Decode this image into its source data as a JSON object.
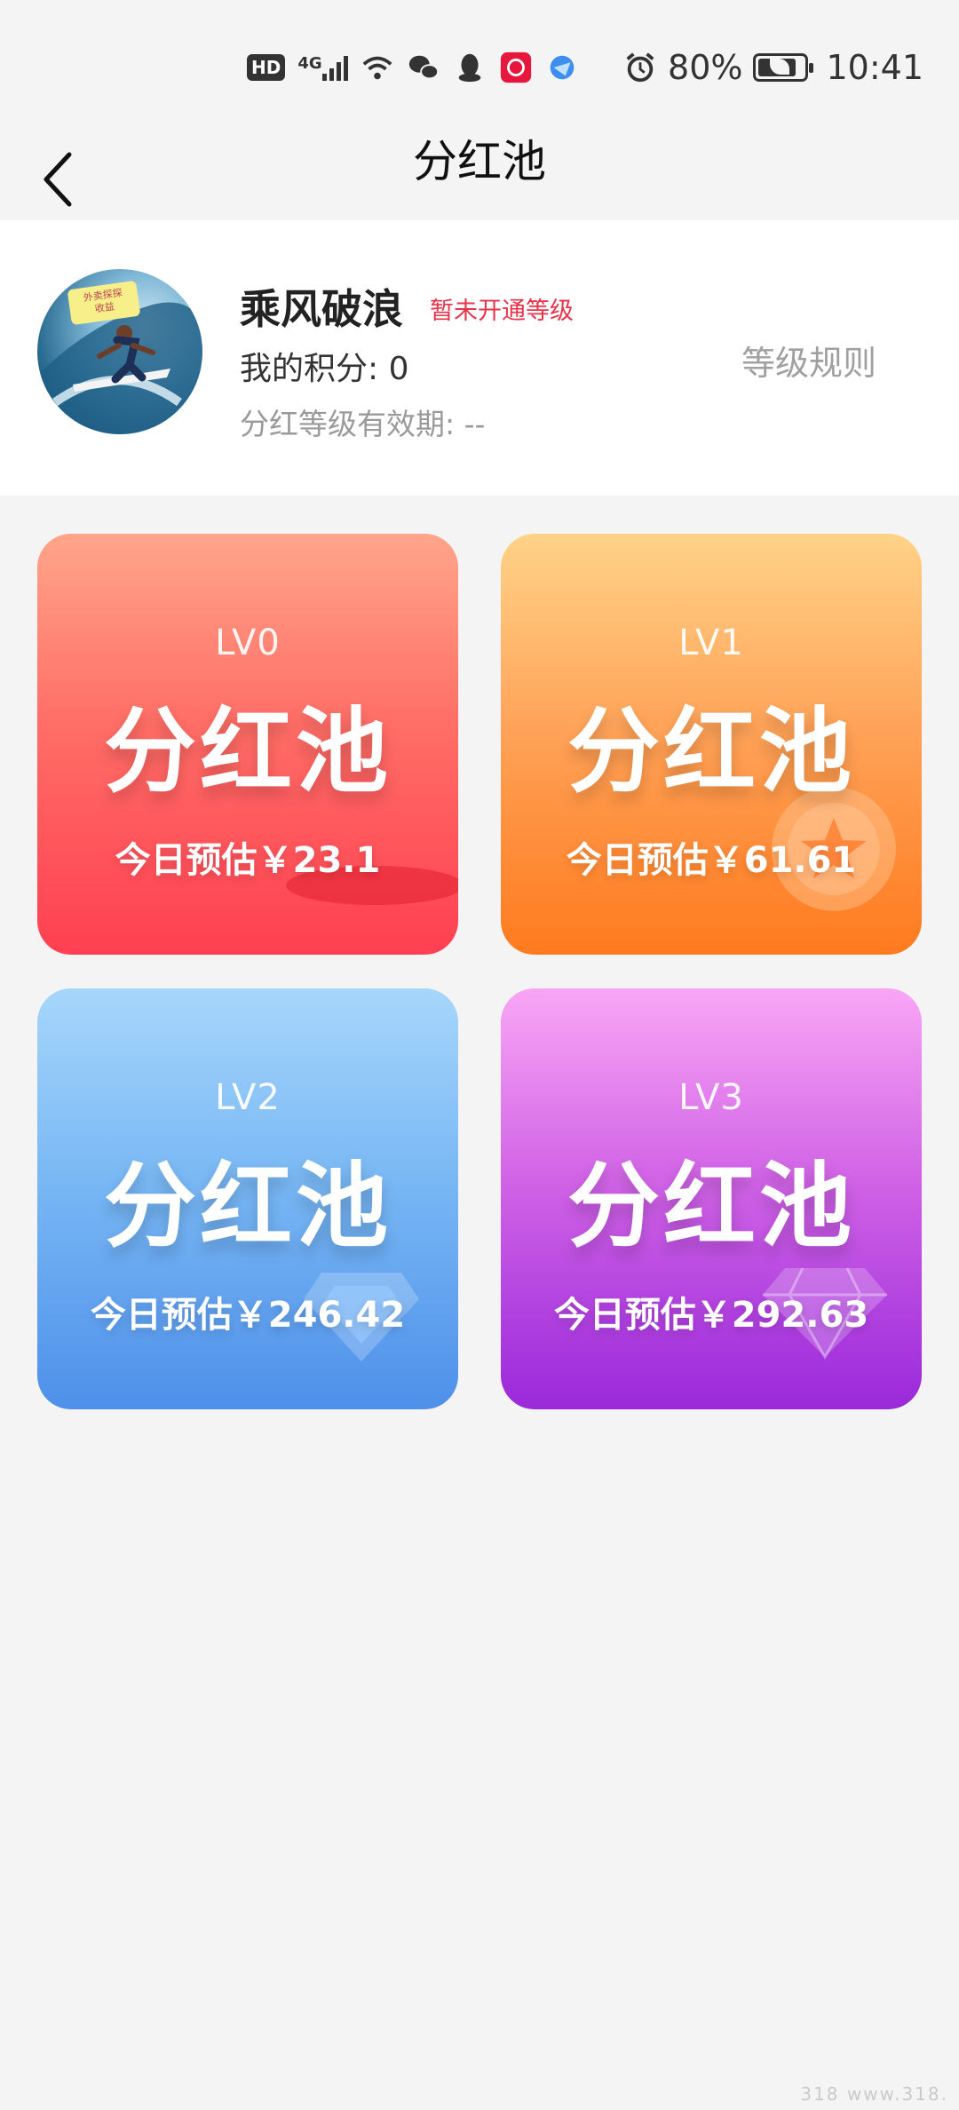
{
  "status_bar": {
    "hd": "HD",
    "network": "4G",
    "battery_percent": "80%",
    "time": "10:41"
  },
  "nav": {
    "title": "分红池",
    "back_icon": "chevron-left-icon"
  },
  "profile": {
    "avatar_tag": "外卖探探\n收益",
    "name": "乘风破浪",
    "level_status": "暂未开通等级",
    "points_label": "我的积分:",
    "points_value": "0",
    "points_text": "我的积分:  0",
    "validity_text": "分红等级有效期:  --",
    "rules_link": "等级规则"
  },
  "pools": [
    {
      "level": "LV0",
      "name": "分红池",
      "estimate": "今日预估￥23.1",
      "color": "#ff4a57"
    },
    {
      "level": "LV1",
      "name": "分红池",
      "estimate": "今日预估￥61.61",
      "color": "#ff8a2e"
    },
    {
      "level": "LV2",
      "name": "分红池",
      "estimate": "今日预估￥246.42",
      "color": "#5b9cee"
    },
    {
      "level": "LV3",
      "name": "分红池",
      "estimate": "今日预估￥292.63",
      "color": "#b43ee0"
    }
  ],
  "watermark": "318 www.318."
}
